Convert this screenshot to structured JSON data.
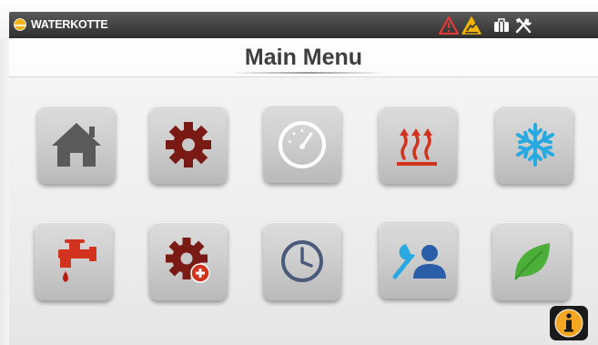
{
  "header": {
    "brand": "WATERKOTTE",
    "status_icons": [
      "alarm-warning-icon",
      "maintenance-warning-icon",
      "briefcase-icon",
      "tools-icon"
    ]
  },
  "title": "Main Menu",
  "menu": {
    "row1": [
      "home-icon",
      "gear-icon",
      "gauge-icon",
      "heating-icon",
      "cooling-icon"
    ],
    "row2": [
      "water-tap-icon",
      "gear-add-icon",
      "clock-icon",
      "service-user-icon",
      "eco-leaf-icon"
    ]
  },
  "footer": {
    "info_icon": "info-icon"
  },
  "colors": {
    "title_text": "#3e3e3e",
    "status_bar": "#3a3a3a",
    "accent_red": "#c62828",
    "accent_orange": "#f5a623",
    "cooling_blue": "#29a9e1",
    "leaf_green": "#4caf3a",
    "slate_blue": "#4a5a7a"
  }
}
